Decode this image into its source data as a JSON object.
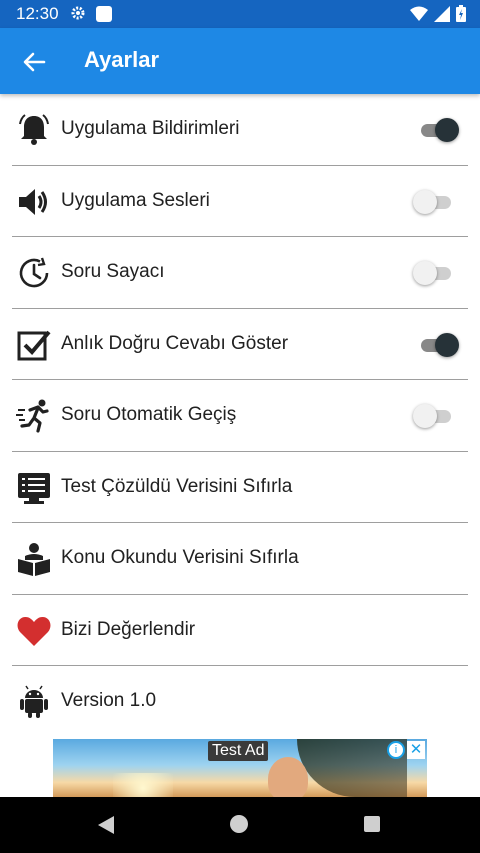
{
  "status_bar": {
    "time": "12:30"
  },
  "app_bar": {
    "title": "Ayarlar"
  },
  "settings": [
    {
      "label": "Uygulama Bildirimleri",
      "icon": "bell-icon",
      "toggle": true
    },
    {
      "label": "Uygulama Sesleri",
      "icon": "speaker-icon",
      "toggle": false
    },
    {
      "label": "Soru Sayacı",
      "icon": "timer-icon",
      "toggle": false
    },
    {
      "label": "Anlık Doğru Cevabı Göster",
      "icon": "checkbox-icon",
      "toggle": true
    },
    {
      "label": "Soru Otomatik Geçiş",
      "icon": "running-icon",
      "toggle": false
    },
    {
      "label": "Test Çözüldü Verisini Sıfırla",
      "icon": "monitor-list-icon"
    },
    {
      "label": "Konu Okundu Verisini Sıfırla",
      "icon": "reading-icon"
    },
    {
      "label": "Bizi Değerlendir",
      "icon": "heart-icon"
    },
    {
      "label": "Version 1.0",
      "icon": "android-icon"
    }
  ],
  "ad": {
    "label": "Test Ad",
    "info": "i",
    "close": "✕"
  },
  "colors": {
    "status_bar": "#1565c0",
    "app_bar": "#1e88e5",
    "heart": "#d32f2f",
    "switch_on": "#263238"
  }
}
